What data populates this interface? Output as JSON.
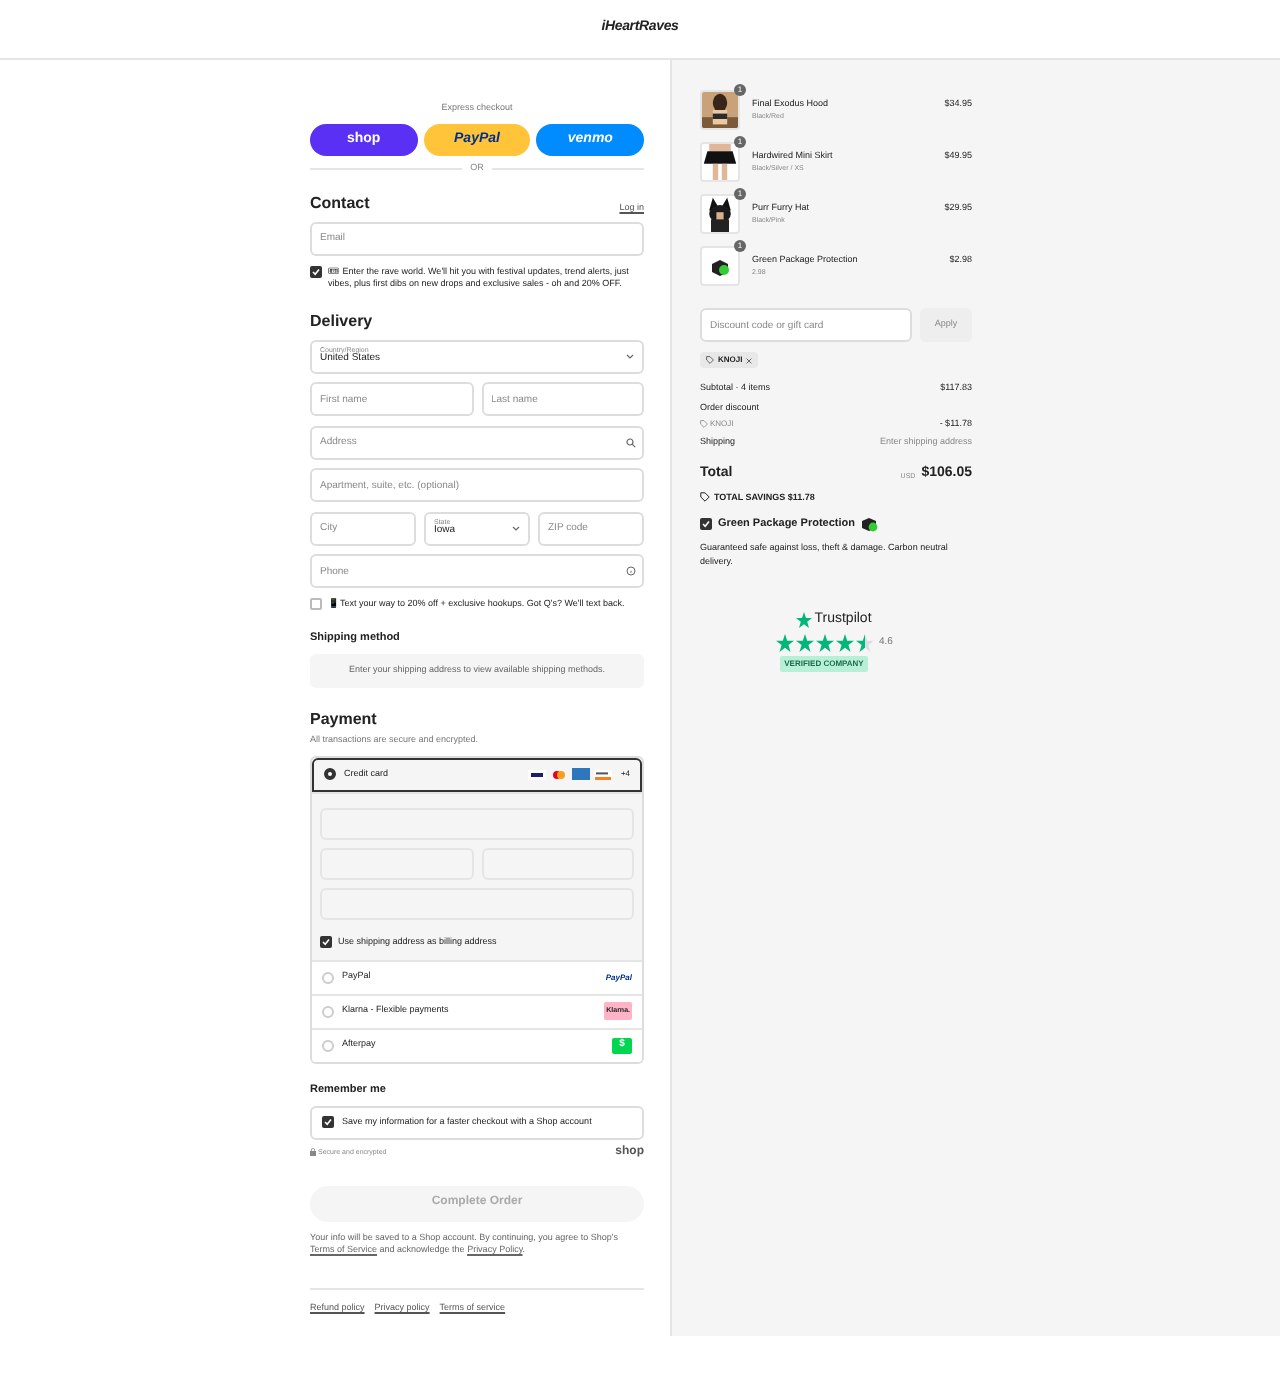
{
  "header": {
    "logo": "iHeartRaves"
  },
  "express": {
    "title": "Express checkout",
    "buttons": [
      {
        "kind": "shop",
        "label": "shop"
      },
      {
        "kind": "paypal",
        "label": "PayPal"
      },
      {
        "kind": "venmo",
        "label": "venmo"
      }
    ],
    "divider": "OR"
  },
  "contact": {
    "title": "Contact",
    "login": "Log in",
    "email": {
      "placeholder": "Email"
    },
    "newsletter": {
      "checked": true,
      "text": "🎟 Enter the rave world. We'll hit you with festival updates, trend alerts, just vibes, plus first dibs on new drops and exclusive sales - oh and 20% OFF."
    }
  },
  "delivery": {
    "title": "Delivery",
    "country": {
      "label": "Country/Region",
      "value": "United States"
    },
    "first_name": {
      "placeholder": "First name"
    },
    "last_name": {
      "placeholder": "Last name"
    },
    "address": {
      "placeholder": "Address"
    },
    "apartment": {
      "placeholder": "Apartment, suite, etc. (optional)"
    },
    "city": {
      "placeholder": "City"
    },
    "state": {
      "label": "State",
      "value": "Iowa"
    },
    "zip": {
      "placeholder": "ZIP code"
    },
    "phone": {
      "placeholder": "Phone"
    },
    "sms": {
      "checked": false,
      "text": "📱Text your way to 20% off + exclusive hookups. Got Q's? We'll text back."
    }
  },
  "shipping_method": {
    "title": "Shipping method",
    "message": "Enter your shipping address to view available shipping methods."
  },
  "payment": {
    "title": "Payment",
    "subtitle": "All transactions are secure and encrypted.",
    "methods": [
      {
        "kind": "card",
        "label": "Credit card",
        "selected": true,
        "more": "+4"
      },
      {
        "kind": "paypal",
        "label": "PayPal",
        "selected": false,
        "logo": "PayPal"
      },
      {
        "kind": "klarna",
        "label": "Klarna - Flexible payments",
        "selected": false,
        "logo": "Klarna."
      },
      {
        "kind": "afterpay",
        "label": "Afterpay",
        "selected": false,
        "logo": "$"
      }
    ],
    "billing": {
      "checked": true,
      "text": "Use shipping address as billing address"
    }
  },
  "remember": {
    "title": "Remember me",
    "save": {
      "checked": true,
      "text": "Save my information for a faster checkout with a Shop account"
    },
    "secure": "Secure and encrypted",
    "shop_logo": "shop"
  },
  "complete_button": "Complete Order",
  "legal": [
    {
      "kind": "text",
      "text": "Your info will be saved to a Shop account. By continuing, you agree to Shop's "
    },
    {
      "kind": "link",
      "text": "Terms of Service"
    },
    {
      "kind": "text",
      "text": " and acknowledge the "
    },
    {
      "kind": "link",
      "text": "Privacy Policy"
    },
    {
      "kind": "text",
      "text": "."
    }
  ],
  "footer_links": [
    "Refund policy",
    "Privacy policy",
    "Terms of service"
  ],
  "cart": {
    "items": [
      {
        "kind": "product",
        "quantity": "1",
        "name": "Final Exodus Hood",
        "variant": "Black/Red",
        "price": "$34.95"
      },
      {
        "kind": "product",
        "quantity": "1",
        "name": "Hardwired Mini Skirt",
        "variant": "Black/Silver / XS",
        "price": "$49.95"
      },
      {
        "kind": "product",
        "quantity": "1",
        "name": "Purr Furry Hat",
        "variant": "Black/Pink",
        "price": "$29.95"
      },
      {
        "kind": "protection",
        "quantity": "1",
        "name": "Green Package Protection",
        "variant": "2.98",
        "price": "$2.98"
      }
    ],
    "discount": {
      "placeholder": "Discount code or gift card",
      "button": "Apply",
      "tag": "KNOJI"
    },
    "subtotal": {
      "label": "Subtotal · 4 items",
      "value": "$117.83"
    },
    "order_discount": {
      "label": "Order discount",
      "code": "KNOJI",
      "value": "- $11.78"
    },
    "shipping": {
      "label": "Shipping",
      "value": "Enter shipping address"
    },
    "total": {
      "label": "Total",
      "currency": "USD",
      "value": "$106.05"
    },
    "savings": "TOTAL SAVINGS $11.78",
    "protection": {
      "checked": true,
      "title": "Green Package Protection",
      "text": "Guaranteed safe against loss, theft & damage. Carbon neutral delivery."
    },
    "trustpilot": {
      "name": "Trustpilot",
      "stars": 4.5,
      "score": "4.6",
      "badge": "VERIFIED COMPANY"
    }
  }
}
